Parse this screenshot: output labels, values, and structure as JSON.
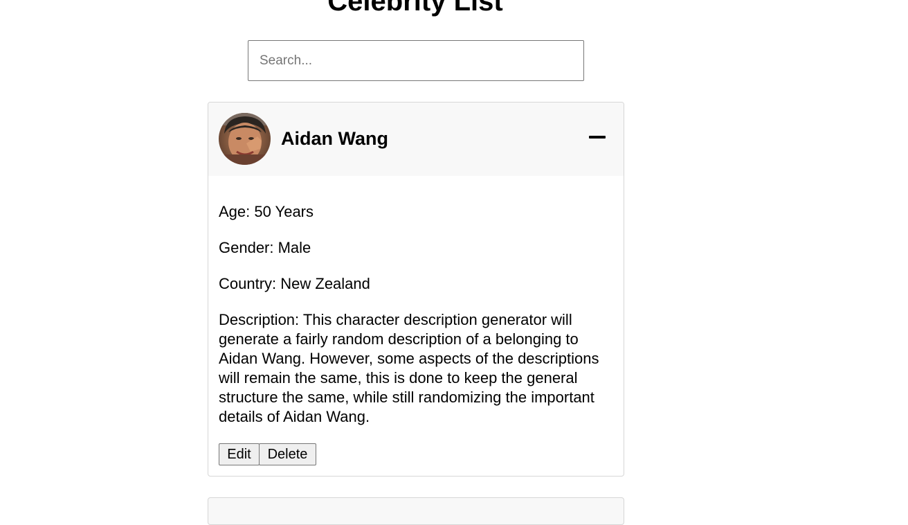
{
  "page": {
    "title": "Celebrity List"
  },
  "search": {
    "placeholder": "Search...",
    "value": ""
  },
  "celebrities": [
    {
      "name": "Aidan Wang",
      "expanded": true,
      "age_text": "Age: 50 Years",
      "gender_text": "Gender: Male",
      "country_text": "Country: New Zealand",
      "description_text": "Description: This character description generator will generate a fairly random description of a belonging to Aidan Wang. However, some aspects of the descriptions will remain the same, this is done to keep the general structure the same, while still randomizing the important details of Aidan Wang.",
      "edit_label": "Edit",
      "delete_label": "Delete"
    }
  ],
  "icons": {
    "collapse": "minus-icon"
  }
}
